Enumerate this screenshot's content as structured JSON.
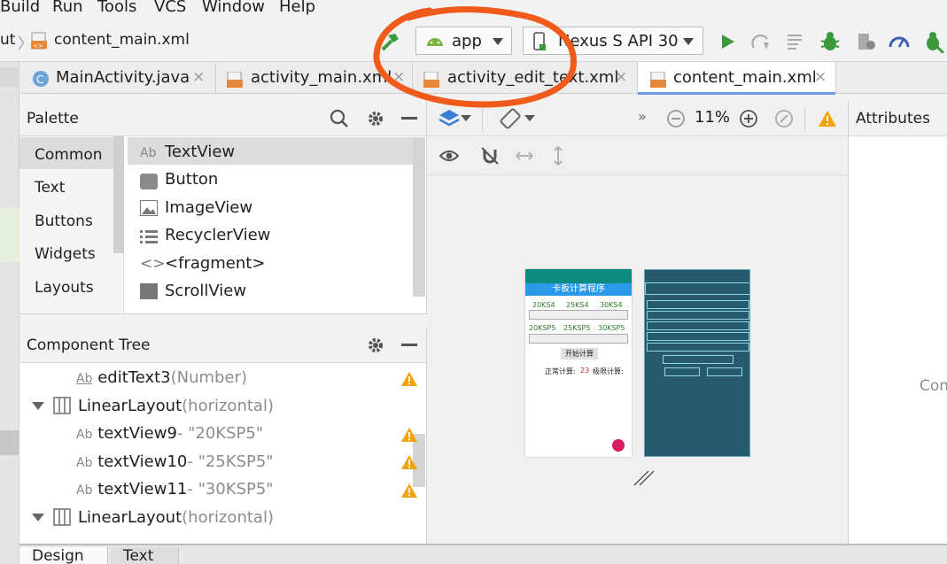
{
  "menu": [
    "Build",
    "Run",
    "Tools",
    "VCS",
    "Window",
    "Help"
  ],
  "breadcrumb": {
    "prefix": "ut",
    "file": "content_main.xml"
  },
  "run_config": {
    "label": "app"
  },
  "device": {
    "label": "Nexus S API 30"
  },
  "tabs": [
    {
      "label": "MainActivity.java",
      "close": "×"
    },
    {
      "label": "activity_main.xml",
      "close": "×"
    },
    {
      "label": "activity_edit_text.xml",
      "close": "×"
    },
    {
      "label": "content_main.xml",
      "close": "×"
    }
  ],
  "palette": {
    "title": "Palette",
    "categories": [
      "Common",
      "Text",
      "Buttons",
      "Widgets",
      "Layouts"
    ],
    "items": [
      {
        "prefix": "Ab",
        "label": "TextView"
      },
      {
        "label": "Button"
      },
      {
        "label": "ImageView"
      },
      {
        "label": "RecyclerView"
      },
      {
        "prefix": "<>",
        "label": "<fragment>"
      },
      {
        "label": "ScrollView"
      }
    ]
  },
  "tree": {
    "title": "Component Tree",
    "rows": [
      {
        "prefix": "Ab",
        "name": "editText3",
        "detail": "(Number)"
      },
      {
        "name": "LinearLayout",
        "detail": "(horizontal)"
      },
      {
        "prefix": "Ab",
        "name": "textView9",
        "detail": "- \"20KSP5\""
      },
      {
        "prefix": "Ab",
        "name": "textView10",
        "detail": "- \"25KSP5\""
      },
      {
        "prefix": "Ab",
        "name": "textView11",
        "detail": "- \"30KSP5\""
      },
      {
        "name": "LinearLayout",
        "detail": "(horizontal)"
      }
    ]
  },
  "design": {
    "zoom": "11%",
    "chevrons": "»",
    "phone": {
      "title": "卡板计算程序",
      "row1": [
        "20KS4",
        "25KS4",
        "30KS4"
      ],
      "row2": [
        "20KSP5",
        "25KSP5",
        "30KSP5"
      ],
      "button": "开始计算",
      "normal_label": "正常计算:",
      "normal_value": "23",
      "limit_label": "极限计算:"
    }
  },
  "attributes": {
    "title": "Attributes",
    "partial": "Con"
  },
  "bottom_tabs": [
    "Design",
    "Text"
  ],
  "colors": {
    "accent": "#6d9be0",
    "annotation": "#f05a1a",
    "teal": "#0f8a7e",
    "blueprint": "#275b6c",
    "warning": "#f0a30a",
    "run_green": "#3c9a3c"
  }
}
